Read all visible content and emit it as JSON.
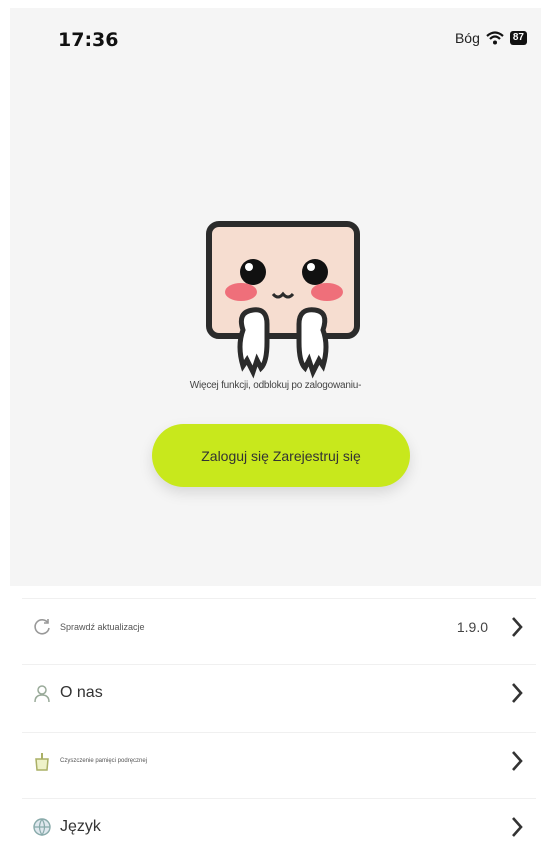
{
  "status_bar": {
    "time": "17:36",
    "carrier": "Bóg",
    "battery": "87"
  },
  "hero": {
    "hint": "Więcej funkcji, odblokuj po zalogowaniu-",
    "login_label": "Zaloguj się Zarejestruj się"
  },
  "menu": {
    "items": [
      {
        "label": "Sprawdź aktualizacje",
        "value": "1.9.0",
        "icon": "refresh-icon"
      },
      {
        "label": "O nas",
        "value": "",
        "icon": "person-icon"
      },
      {
        "label": "Czyszczenie pamięci podręcznej",
        "value": "",
        "icon": "trash-icon"
      },
      {
        "label": "Język",
        "value": "",
        "icon": "globe-icon"
      }
    ]
  },
  "colors": {
    "accent": "#c8e81c",
    "hero_bg": "#f5f5f5",
    "cheek": "#ef6f7a",
    "face": "#f6ddd0"
  }
}
